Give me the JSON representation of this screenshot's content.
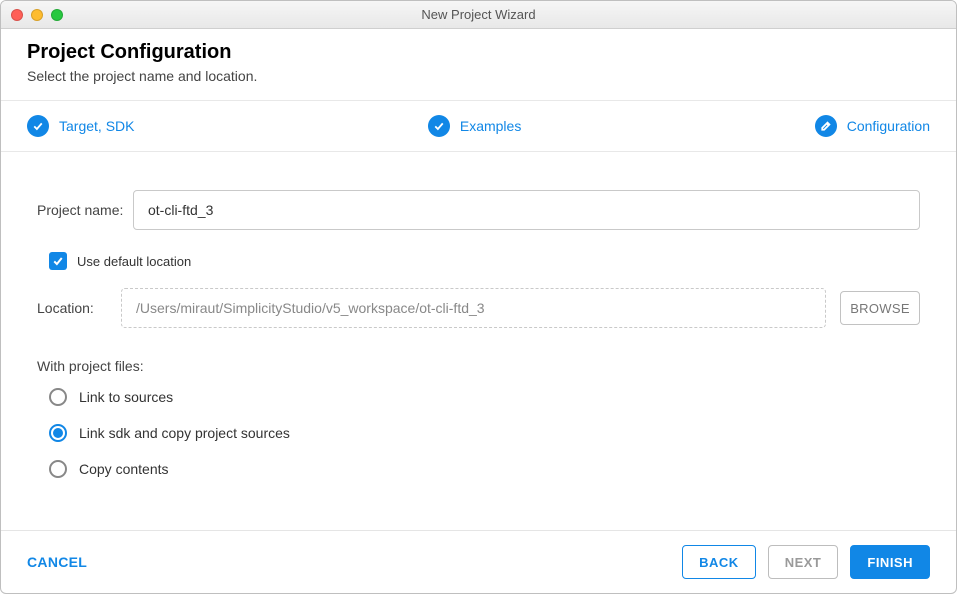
{
  "window": {
    "title": "New Project Wizard"
  },
  "header": {
    "title": "Project Configuration",
    "subtitle": "Select the project name and location."
  },
  "steps": {
    "target": {
      "label": "Target, SDK",
      "icon": "check"
    },
    "examples": {
      "label": "Examples",
      "icon": "check"
    },
    "configuration": {
      "label": "Configuration",
      "icon": "pencil"
    }
  },
  "form": {
    "project_name_label": "Project name:",
    "project_name_value": "ot-cli-ftd_3",
    "use_default_location_label": "Use default location",
    "use_default_location_checked": true,
    "location_label": "Location:",
    "location_value": "/Users/miraut/SimplicityStudio/v5_workspace/ot-cli-ftd_3",
    "browse_label": "BROWSE",
    "with_project_files_label": "With project files:",
    "radios": {
      "link_sources": {
        "label": "Link to sources",
        "checked": false
      },
      "link_sdk_copy": {
        "label": "Link sdk and copy project sources",
        "checked": true
      },
      "copy_contents": {
        "label": "Copy contents",
        "checked": false
      }
    }
  },
  "footer": {
    "cancel": "CANCEL",
    "back": "BACK",
    "next": "NEXT",
    "finish": "FINISH"
  }
}
